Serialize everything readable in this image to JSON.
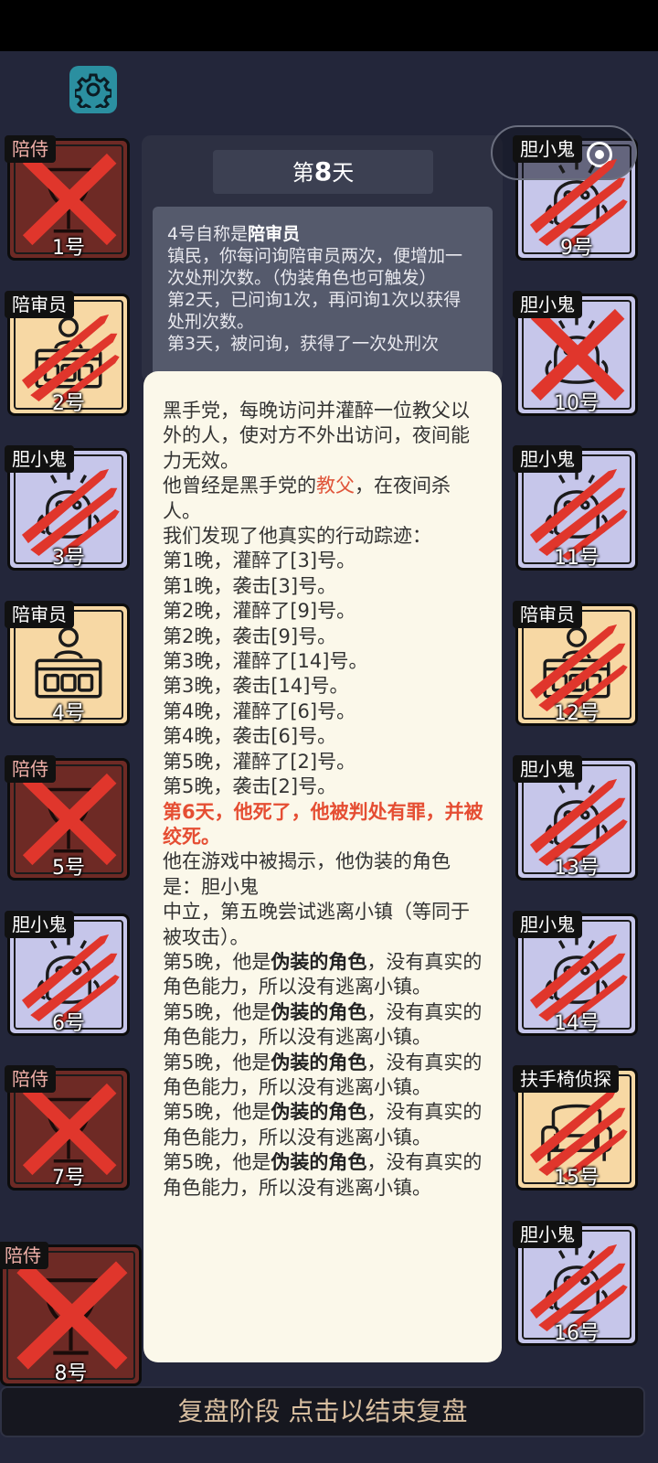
{
  "header": {
    "day_prefix": "第",
    "day_number": "8",
    "day_suffix": "天"
  },
  "info": {
    "claim_prefix": "4号自称是",
    "claim_role": "陪审员",
    "desc": "镇民，你每问询陪审员两次，便增加一次处刑次数。（伪装角色也可触发）",
    "line2": "第2天，已问询1次，再问询1次以获得处刑次数。",
    "line3": "第3天，被问询，获得了一次处刑次"
  },
  "detail": {
    "intro": "黑手党，每晚访问并灌醉一位教父以外的人，使对方不外出访问，夜间能力无效。",
    "was_prefix": "他曾经是黑手党的",
    "was_role": "教父",
    "was_suffix": "，在夜间杀人。",
    "found": "我们发现了他真实的行动踪迹：",
    "actions": [
      "第1晚，灌醉了[3]号。",
      "第1晚，袭击[3]号。",
      "第2晚，灌醉了[9]号。",
      "第2晚，袭击[9]号。",
      "第3晚，灌醉了[14]号。",
      "第3晚，袭击[14]号。",
      "第4晚，灌醉了[6]号。",
      "第4晚，袭击[6]号。",
      "第5晚，灌醉了[2]号。",
      "第5晚，袭击[2]号。"
    ],
    "death": "第6天，他死了，他被判处有罪，并被绞死。",
    "reveal": "他在游戏中被揭示，他伪装的角色是：胆小鬼",
    "reveal_desc": "中立，第五晚尝试逃离小镇（等同于被攻击）。",
    "fake_prefix": "第5晚，他是",
    "fake_bold": "伪装的角色",
    "fake_suffix": "，没有真实的角色能力，所以没有逃离小镇。"
  },
  "players": [
    {
      "num": "1号",
      "role": "陪侍",
      "status": "dead",
      "mark": "x"
    },
    {
      "num": "2号",
      "role": "陪审员",
      "status": "alive",
      "mark": "claw"
    },
    {
      "num": "3号",
      "role": "胆小鬼",
      "status": "coward",
      "mark": "claw"
    },
    {
      "num": "4号",
      "role": "陪审员",
      "status": "alive",
      "mark": "none"
    },
    {
      "num": "5号",
      "role": "陪侍",
      "status": "dead",
      "mark": "x"
    },
    {
      "num": "6号",
      "role": "胆小鬼",
      "status": "coward",
      "mark": "claw"
    },
    {
      "num": "7号",
      "role": "陪侍",
      "status": "dead",
      "mark": "x"
    },
    {
      "num": "8号",
      "role": "陪侍",
      "status": "dead",
      "mark": "x"
    },
    {
      "num": "9号",
      "role": "胆小鬼",
      "status": "coward",
      "mark": "claw"
    },
    {
      "num": "10号",
      "role": "胆小鬼",
      "status": "coward",
      "mark": "x"
    },
    {
      "num": "11号",
      "role": "胆小鬼",
      "status": "coward",
      "mark": "claw"
    },
    {
      "num": "12号",
      "role": "陪审员",
      "status": "alive",
      "mark": "claw"
    },
    {
      "num": "13号",
      "role": "胆小鬼",
      "status": "coward",
      "mark": "claw"
    },
    {
      "num": "14号",
      "role": "胆小鬼",
      "status": "coward",
      "mark": "claw"
    },
    {
      "num": "15号",
      "role": "扶手椅侦探",
      "status": "alive",
      "mark": "claw"
    },
    {
      "num": "16号",
      "role": "胆小鬼",
      "status": "coward",
      "mark": "claw"
    }
  ],
  "footer": {
    "label": "复盘阶段 点击以结束复盘"
  },
  "colors": {
    "background": "#23263a",
    "dead_card": "#6e2a25",
    "alive_card": "#f7d8a4",
    "coward_card": "#c6c6ea",
    "mark_red": "#e0362c",
    "highlight_red": "#e0553a",
    "footer_text": "#d9bfa0"
  },
  "icons": {
    "settings": "gear-icon",
    "menu": "more-dots-icon",
    "close": "target-circle-icon"
  }
}
